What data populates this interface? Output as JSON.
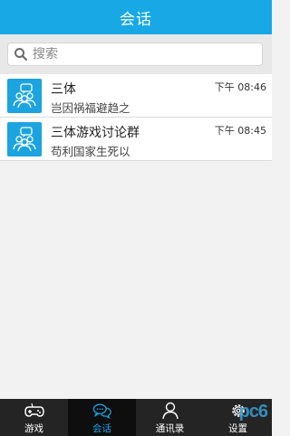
{
  "header": {
    "title": "会话"
  },
  "search": {
    "placeholder": "搜索"
  },
  "conversations": [
    {
      "title": "三体",
      "message": "岂因祸福避趋之",
      "time": "下午 08:46"
    },
    {
      "title": "三体游戏讨论群",
      "message": "苟利国家生死以",
      "time": "下午 08:45"
    }
  ],
  "tabs": [
    {
      "label": "游戏",
      "icon": "gamepad-icon",
      "active": false
    },
    {
      "label": "会话",
      "icon": "chat-bubbles-icon",
      "active": true
    },
    {
      "label": "通讯录",
      "icon": "contact-person-icon",
      "active": false
    },
    {
      "label": "设置",
      "icon": "gear-icon",
      "active": false
    }
  ],
  "watermark": "pc6",
  "colors": {
    "header": "#18a8e6",
    "avatar": "#1ba4e0",
    "tabbar": "#242424",
    "tab_active_label": "#1da7e8"
  }
}
